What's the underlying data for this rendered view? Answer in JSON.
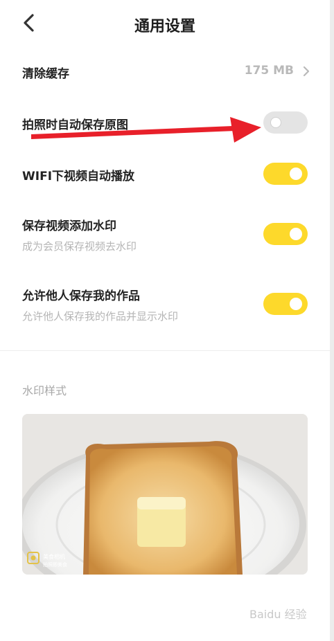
{
  "header": {
    "title": "通用设置"
  },
  "settings": {
    "cache": {
      "label": "清除缓存",
      "value": "175 MB"
    },
    "save_original": {
      "label": "拍照时自动保存原图",
      "enabled": false
    },
    "wifi_autoplay": {
      "label": "WIFI下视频自动播放",
      "enabled": true
    },
    "watermark_video": {
      "label": "保存视频添加水印",
      "sub": "成为会员保存视频去水印",
      "enabled": true
    },
    "allow_save": {
      "label": "允许他人保存我的作品",
      "sub": "允许他人保存我的作品并显示水印",
      "enabled": true
    }
  },
  "watermark_section": {
    "title": "水印样式",
    "preview_logo_line1": "美食相机",
    "preview_logo_line2": "拍照即美食"
  },
  "colors": {
    "accent": "#fdd92b",
    "annotation_arrow": "#e8202a"
  },
  "icons": [
    "chevron-left-icon",
    "chevron-right-icon",
    "red-arrow-annotation"
  ],
  "footer_watermark": "Baidu 经验"
}
